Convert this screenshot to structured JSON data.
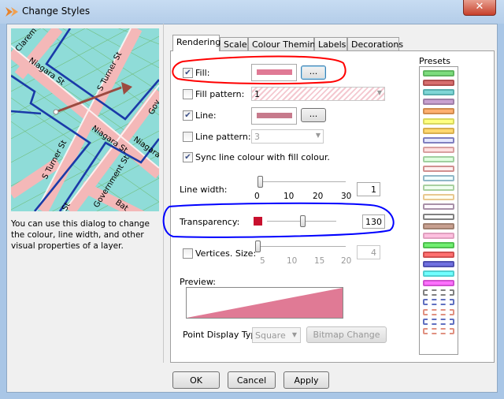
{
  "window": {
    "title": "Change Styles",
    "close_label": "✕",
    "icon": "app-icon"
  },
  "left": {
    "map_labels": [
      "Clarem",
      "Niagara St",
      "S Turner St",
      "Niagara St",
      "S Turner St",
      "Gov",
      "Niagara",
      "Government St",
      "Bat",
      "St"
    ],
    "description": "You can use this dialog to change the colour, line width, and other visual properties of a layer."
  },
  "tabs": [
    {
      "label": "Rendering",
      "active": true
    },
    {
      "label": "Scale"
    },
    {
      "label": "Colour Theming"
    },
    {
      "label": "Labels"
    },
    {
      "label": "Decorations"
    }
  ],
  "rendering": {
    "fill": {
      "label": "Fill:",
      "checked": true,
      "color": "#e07a95",
      "button": "..."
    },
    "fill_pattern": {
      "label": "Fill pattern:",
      "checked": false,
      "value": "1"
    },
    "line": {
      "label": "Line:",
      "checked": true,
      "color": "#c77a8c",
      "button": "..."
    },
    "line_pattern": {
      "label": "Line pattern:",
      "checked": false,
      "value": "3"
    },
    "sync": {
      "label": "Sync line colour with fill colour.",
      "checked": true
    },
    "line_width": {
      "label": "Line width:",
      "ticks": [
        "0",
        "10",
        "20",
        "30"
      ],
      "value": "1",
      "slider_value": 1,
      "min": 0,
      "max": 30
    },
    "transparency": {
      "label": "Transparency:",
      "value": "130",
      "slider_value": 130,
      "min": 0,
      "max": 255,
      "start_color": "#c8102e",
      "end_color": "#ffffff"
    },
    "vertices": {
      "label": "Vertices. Size:",
      "checked": false,
      "ticks": [
        "5",
        "10",
        "15",
        "20"
      ],
      "value": "4"
    },
    "preview": {
      "label": "Preview:",
      "color": "#e07a95"
    },
    "point_display": {
      "label": "Point Display Typ",
      "value": "Square",
      "bitmap_button": "Bitmap Change"
    }
  },
  "presets": {
    "label": "Presets",
    "items": [
      {
        "fill": "#7ddc7d",
        "line": "#5fb65f"
      },
      {
        "fill": "#d86e6e",
        "line": "#b05050"
      },
      {
        "fill": "#7fd6d6",
        "line": "#5ab0b0"
      },
      {
        "fill": "#c8a0d0",
        "line": "#a080a8"
      },
      {
        "fill": "#ffb070",
        "line": "#d08c50"
      },
      {
        "fill": "#ffff80",
        "line": "#d8d860"
      },
      {
        "fill": "#ffd870",
        "line": "#d8b050"
      },
      {
        "fill": "#e4e8ff",
        "line": "#8080c0"
      },
      {
        "fill": "#ffe0e0",
        "line": "#d8a0a0"
      },
      {
        "fill": "#e0ffe0",
        "line": "#a0d0a0"
      },
      {
        "fill": "#fff0f0",
        "line": "#d09090"
      },
      {
        "fill": "#f0ffff",
        "line": "#90b8c8"
      },
      {
        "fill": "#f0fff0",
        "line": "#a8d0a0"
      },
      {
        "fill": "#fffff0",
        "line": "#e8c890"
      },
      {
        "fill": "#fff8ff",
        "line": "#a890a8"
      },
      {
        "fill": "#ffffff",
        "line": "#808080"
      },
      {
        "fill": "#c8a090",
        "line": "#a08070"
      },
      {
        "fill": "#ffc0e0",
        "line": "#e0a0c0"
      },
      {
        "fill": "#70f070",
        "line": "#50c050"
      },
      {
        "fill": "#ff7070",
        "line": "#d05050"
      },
      {
        "fill": "#7070e0",
        "line": "#5050b0"
      },
      {
        "fill": "#70ffff",
        "line": "#50d0d0"
      },
      {
        "fill": "#ff70ff",
        "line": "#d050d0"
      },
      {
        "fill": "#ffffff",
        "line": "#808080",
        "dashed": true
      },
      {
        "fill": "#ffffff",
        "line": "#6070c0",
        "dashed": true
      },
      {
        "fill": "#ffffff",
        "line": "#e09080",
        "dashed": true
      },
      {
        "fill": "#ffffff",
        "line": "#6070c0",
        "dashed": true
      },
      {
        "fill": "#ffffff",
        "line": "#e09080",
        "dashed": true
      }
    ]
  },
  "footer": {
    "ok": "OK",
    "cancel": "Cancel",
    "apply": "Apply"
  },
  "annotations": {
    "fill_highlight_color": "#ff0000",
    "transparency_highlight_color": "#0000ff"
  }
}
